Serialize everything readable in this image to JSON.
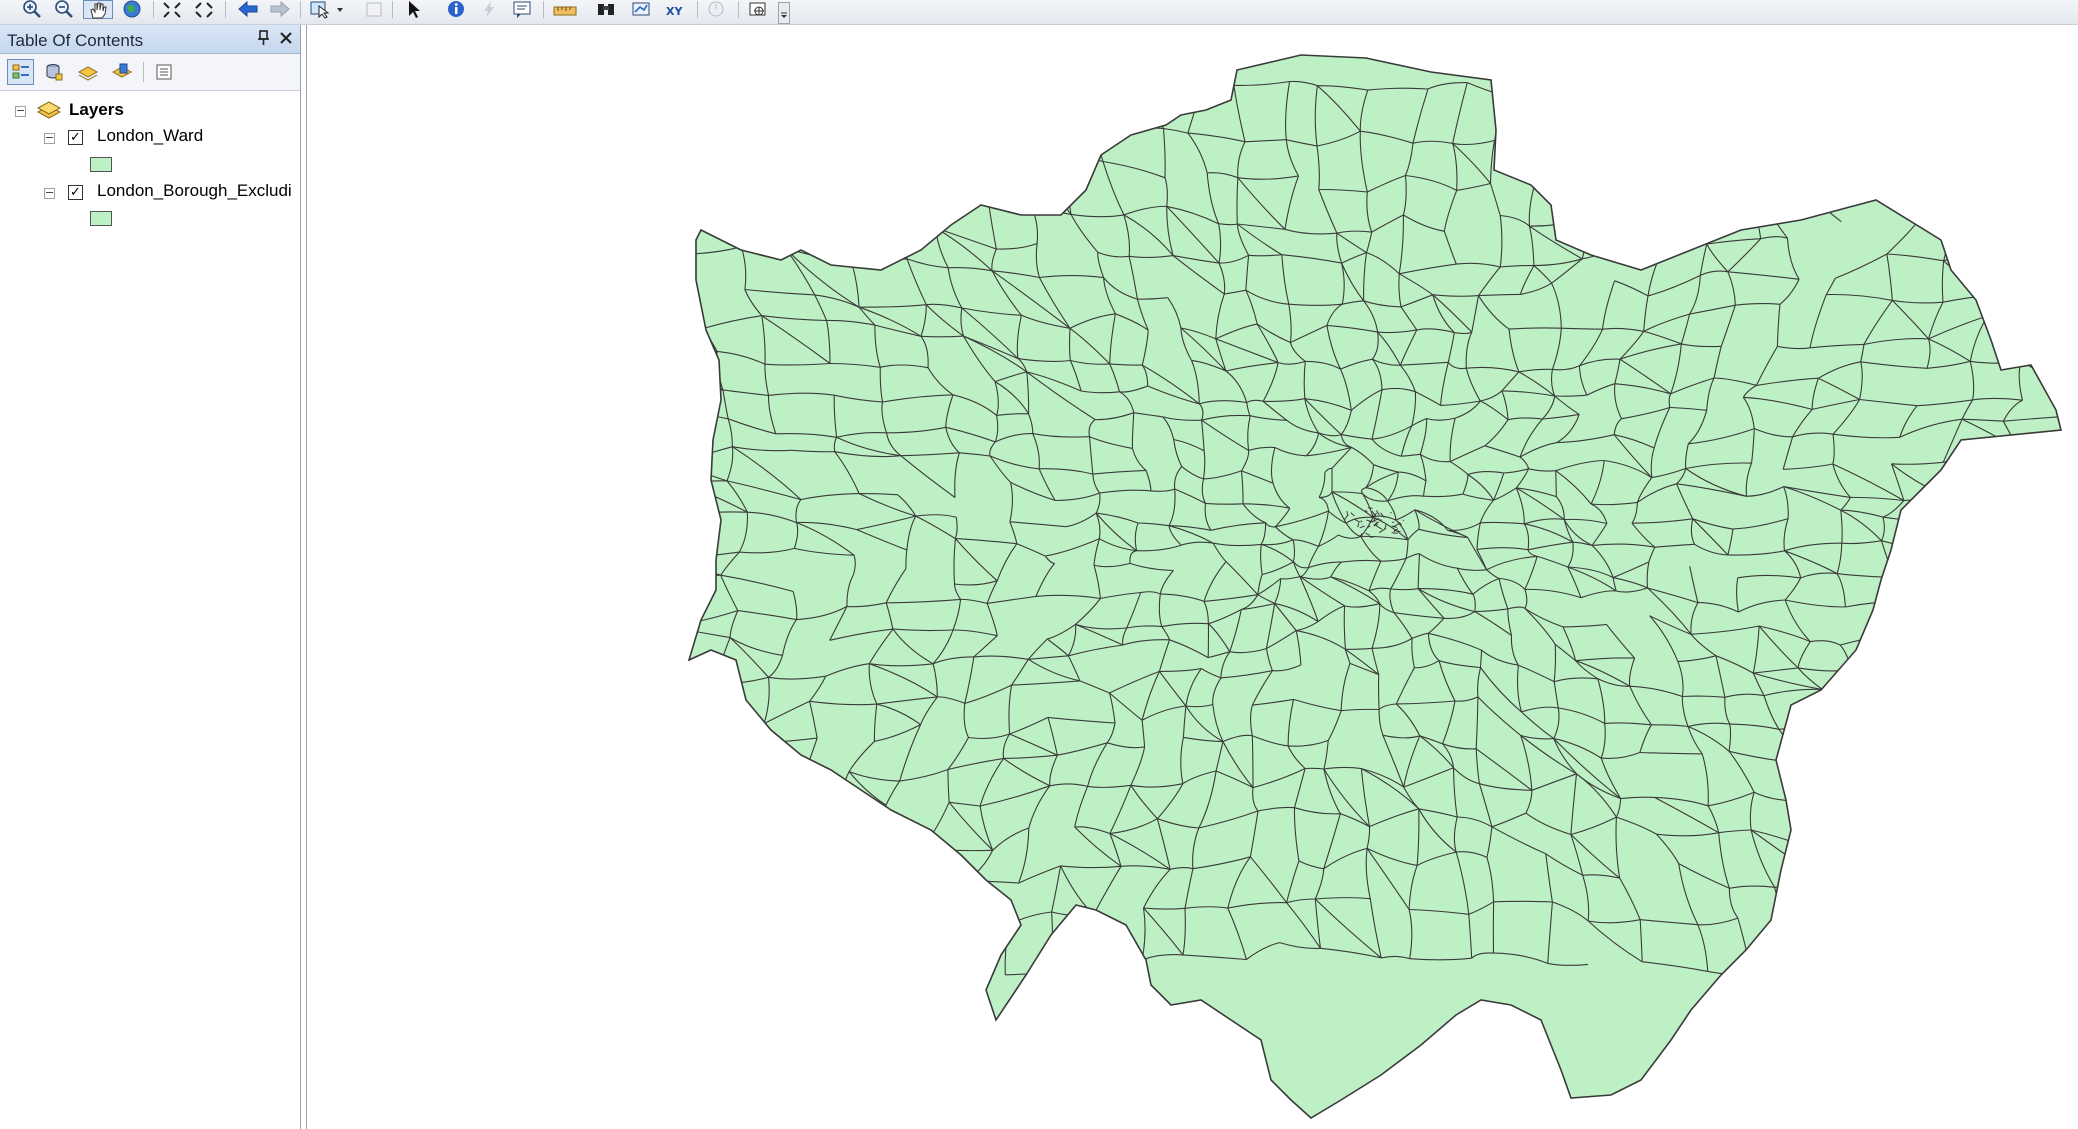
{
  "toolbar": {
    "tools": [
      {
        "name": "zoom-in-icon"
      },
      {
        "name": "zoom-out-icon"
      },
      {
        "name": "pan-hand-icon",
        "active": true
      },
      {
        "name": "full-extent-globe-icon"
      },
      {
        "name": "fixed-zoom-in-icon"
      },
      {
        "name": "fixed-zoom-out-icon"
      },
      {
        "name": "go-back-arrow-icon"
      },
      {
        "name": "go-forward-arrow-icon"
      },
      {
        "name": "select-features-icon"
      },
      {
        "name": "clear-selection-icon"
      },
      {
        "name": "select-elements-arrow-icon"
      },
      {
        "name": "identify-info-icon"
      },
      {
        "name": "hyperlink-lightning-icon"
      },
      {
        "name": "html-popup-icon"
      },
      {
        "name": "measure-ruler-icon"
      },
      {
        "name": "find-binoculars-icon"
      },
      {
        "name": "find-route-icon"
      },
      {
        "name": "go-to-xy-icon"
      },
      {
        "name": "time-slider-icon"
      },
      {
        "name": "create-viewer-window-icon"
      },
      {
        "name": "toolbar-overflow-icon"
      }
    ]
  },
  "toc": {
    "title": "Table Of Contents",
    "toolbar_icons": [
      "list-by-drawing-order-icon",
      "list-by-source-icon",
      "list-by-visibility-icon",
      "list-by-selection-icon",
      "options-icon"
    ],
    "root_label": "Layers",
    "layers": [
      {
        "label": "London_Ward",
        "checked": true,
        "swatch_color": "#bdf0c4"
      },
      {
        "label": "London_Borough_Excludi",
        "checked": true,
        "swatch_color": "#bdf0c4"
      }
    ]
  },
  "map": {
    "fill_color": "#bdf0c4",
    "outline_color": "#3a3a3a"
  }
}
